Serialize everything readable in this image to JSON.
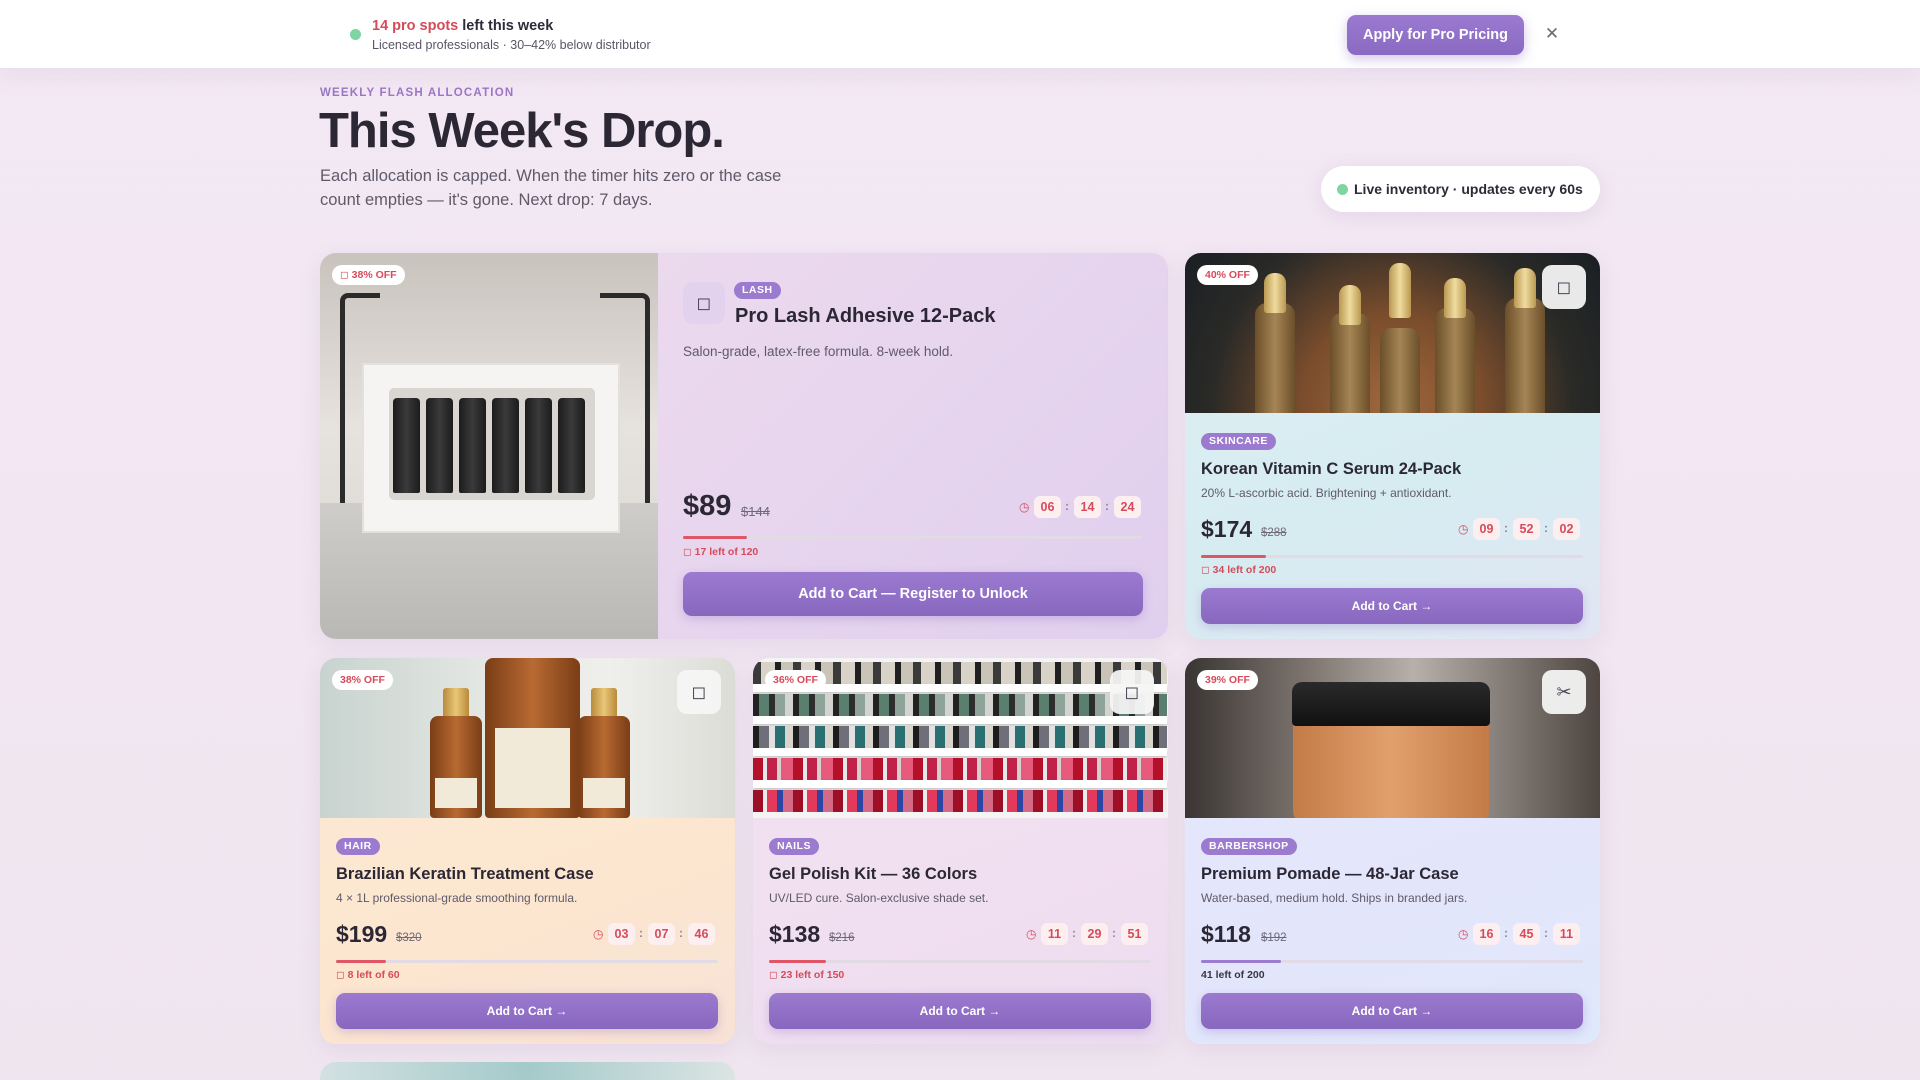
{
  "banner": {
    "spots_highlight": "14 pro spots",
    "spots_rest": " left this week",
    "subline": "Licensed professionals · 30–42% below distributor",
    "apply_label": "Apply for Pro Pricing",
    "close_icon": "close-icon",
    "status_color": "#7fd4a3"
  },
  "header": {
    "eyebrow": "WEEKLY FLASH ALLOCATION",
    "title": "This Week's Drop.",
    "subtitle": "Each allocation is capped. When the timer hits zero or the case count empties — it's gone. Next drop: 7 days.",
    "live_label": "Live inventory · updates every 60s"
  },
  "theme": {
    "accent": "#9b7ad0",
    "danger": "#d64b5a",
    "live": "#7fd4a3"
  },
  "products": [
    {
      "off": "38% OFF",
      "category": "LASH",
      "name": "Pro Lash Adhesive 12-Pack",
      "desc": "Salon-grade, latex-free formula. 8-week hold.",
      "price": "$89",
      "old_price": "$144",
      "timer": [
        "06",
        "14",
        "24"
      ],
      "stock_label": "17 left of 120",
      "stock_fraction": 0.14,
      "cta": "Add to Cart — Register to Unlock",
      "icon": "bookmark-icon"
    },
    {
      "off": "40% OFF",
      "category": "SKINCARE",
      "name": "Korean Vitamin C Serum 24-Pack",
      "desc": "20% L-ascorbic acid. Brightening + antioxidant.",
      "price": "$174",
      "old_price": "$288",
      "timer": [
        "09",
        "52",
        "02"
      ],
      "stock_label": "34 left of 200",
      "stock_fraction": 0.17,
      "cta": "Add to Cart →",
      "icon": "bookmark-icon"
    },
    {
      "off": "38% OFF",
      "category": "HAIR",
      "name": "Brazilian Keratin Treatment Case",
      "desc": "4 × 1L professional-grade smoothing formula.",
      "price": "$199",
      "old_price": "$320",
      "timer": [
        "03",
        "07",
        "46"
      ],
      "stock_label": "8 left of 60",
      "stock_fraction": 0.13,
      "cta": "Add to Cart →",
      "icon": "bookmark-icon"
    },
    {
      "off": "36% OFF",
      "category": "NAILS",
      "name": "Gel Polish Kit — 36 Colors",
      "desc": "UV/LED cure. Salon-exclusive shade set.",
      "price": "$138",
      "old_price": "$216",
      "timer": [
        "11",
        "29",
        "51"
      ],
      "stock_label": "23 left of 150",
      "stock_fraction": 0.15,
      "cta": "Add to Cart →",
      "icon": "bookmark-icon"
    },
    {
      "off": "39% OFF",
      "category": "BARBERSHOP",
      "name": "Premium Pomade — 48-Jar Case",
      "desc": "Water-based, medium hold. Ships in branded jars.",
      "price": "$118",
      "old_price": "$192",
      "timer": [
        "16",
        "45",
        "11"
      ],
      "stock_label": "41 left of 200",
      "stock_fraction": 0.21,
      "cta": "Add to Cart →",
      "icon": "scissors-icon"
    }
  ]
}
